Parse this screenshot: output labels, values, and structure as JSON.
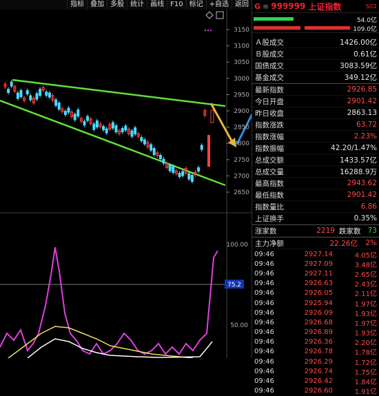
{
  "toolbar": {
    "items": [
      "指标",
      "叠加",
      "多股",
      "统计",
      "画线",
      "F10",
      "标记",
      "+自选",
      "返回"
    ]
  },
  "chart": {
    "price_ticks": [
      "3150",
      "3100",
      "3050",
      "3000",
      "2950",
      "2900",
      "2850",
      "2800",
      "2750",
      "2700",
      "2650"
    ],
    "indicator_ticks": [
      "100.00",
      "75.2",
      "50.00"
    ],
    "current_indicator": "75.2",
    "marker_icon": "diamond-icon"
  },
  "header": {
    "logo": "G",
    "menu_icon": "menu-icon",
    "code": "999999",
    "name": "上证指数",
    "badge": "SG1",
    "bar_top_value": "54.0亿",
    "bar_bottom_value": "109.0亿"
  },
  "stats": [
    {
      "label": "Ａ股成交",
      "value": "1426.00亿",
      "color": "white"
    },
    {
      "label": "Ｂ股成交",
      "value": "0.61亿",
      "color": "white"
    },
    {
      "label": "国债成交",
      "value": "3083.59亿",
      "color": "white"
    },
    {
      "label": "基金成交",
      "value": "349.12亿",
      "color": "white"
    },
    {
      "label": "最新指数",
      "value": "2926.85",
      "color": "red"
    },
    {
      "label": "今日开盘",
      "value": "2901.42",
      "color": "red"
    },
    {
      "label": "昨日收盘",
      "value": "2863.13",
      "color": "white"
    },
    {
      "label": "指数涨跌",
      "value": "63.72",
      "color": "red"
    },
    {
      "label": "指数涨幅",
      "value": "2.23%",
      "color": "red"
    },
    {
      "label": "指数振幅",
      "value": "42.20/1.47%",
      "color": "white"
    },
    {
      "label": "总成交额",
      "value": "1433.57亿",
      "color": "white"
    },
    {
      "label": "总成交量",
      "value": "16288.9万",
      "color": "white"
    },
    {
      "label": "最高指数",
      "value": "2943.62",
      "color": "red"
    },
    {
      "label": "最低指数",
      "value": "2901.42",
      "color": "red"
    },
    {
      "label": "指数量比",
      "value": "6.86",
      "color": "red"
    },
    {
      "label": "上证换手",
      "value": "0.35%",
      "color": "white"
    }
  ],
  "updown": {
    "up_label": "涨家数",
    "up": "2219",
    "down_label": "跌家数",
    "down": "73"
  },
  "netflow": {
    "label": "主力净额",
    "value": "22.26亿",
    "pct": "2%"
  },
  "trades": [
    {
      "time": "09:46",
      "price": "2927.14",
      "vol": "4.05亿"
    },
    {
      "time": "09:46",
      "price": "2927.09",
      "vol": "3.48亿"
    },
    {
      "time": "09:46",
      "price": "2927.11",
      "vol": "2.65亿"
    },
    {
      "time": "09:46",
      "price": "2926.63",
      "vol": "2.43亿"
    },
    {
      "time": "09:46",
      "price": "2926.05",
      "vol": "2.11亿"
    },
    {
      "time": "09:46",
      "price": "2925.94",
      "vol": "1.97亿"
    },
    {
      "time": "09:46",
      "price": "2926.09",
      "vol": "1.93亿"
    },
    {
      "time": "09:46",
      "price": "2926.68",
      "vol": "1.97亿"
    },
    {
      "time": "09:46",
      "price": "2926.89",
      "vol": "1.93亿"
    },
    {
      "time": "09:46",
      "price": "2926.36",
      "vol": "2.20亿"
    },
    {
      "time": "09:46",
      "price": "2926.78",
      "vol": "1.78亿"
    },
    {
      "time": "09:46",
      "price": "2926.29",
      "vol": "1.72亿"
    },
    {
      "time": "09:46",
      "price": "2926.74",
      "vol": "1.75亿"
    },
    {
      "time": "09:46",
      "price": "2926.42",
      "vol": "1.84亿"
    },
    {
      "time": "09:46",
      "price": "2926.60",
      "vol": "1.91亿"
    }
  ]
}
